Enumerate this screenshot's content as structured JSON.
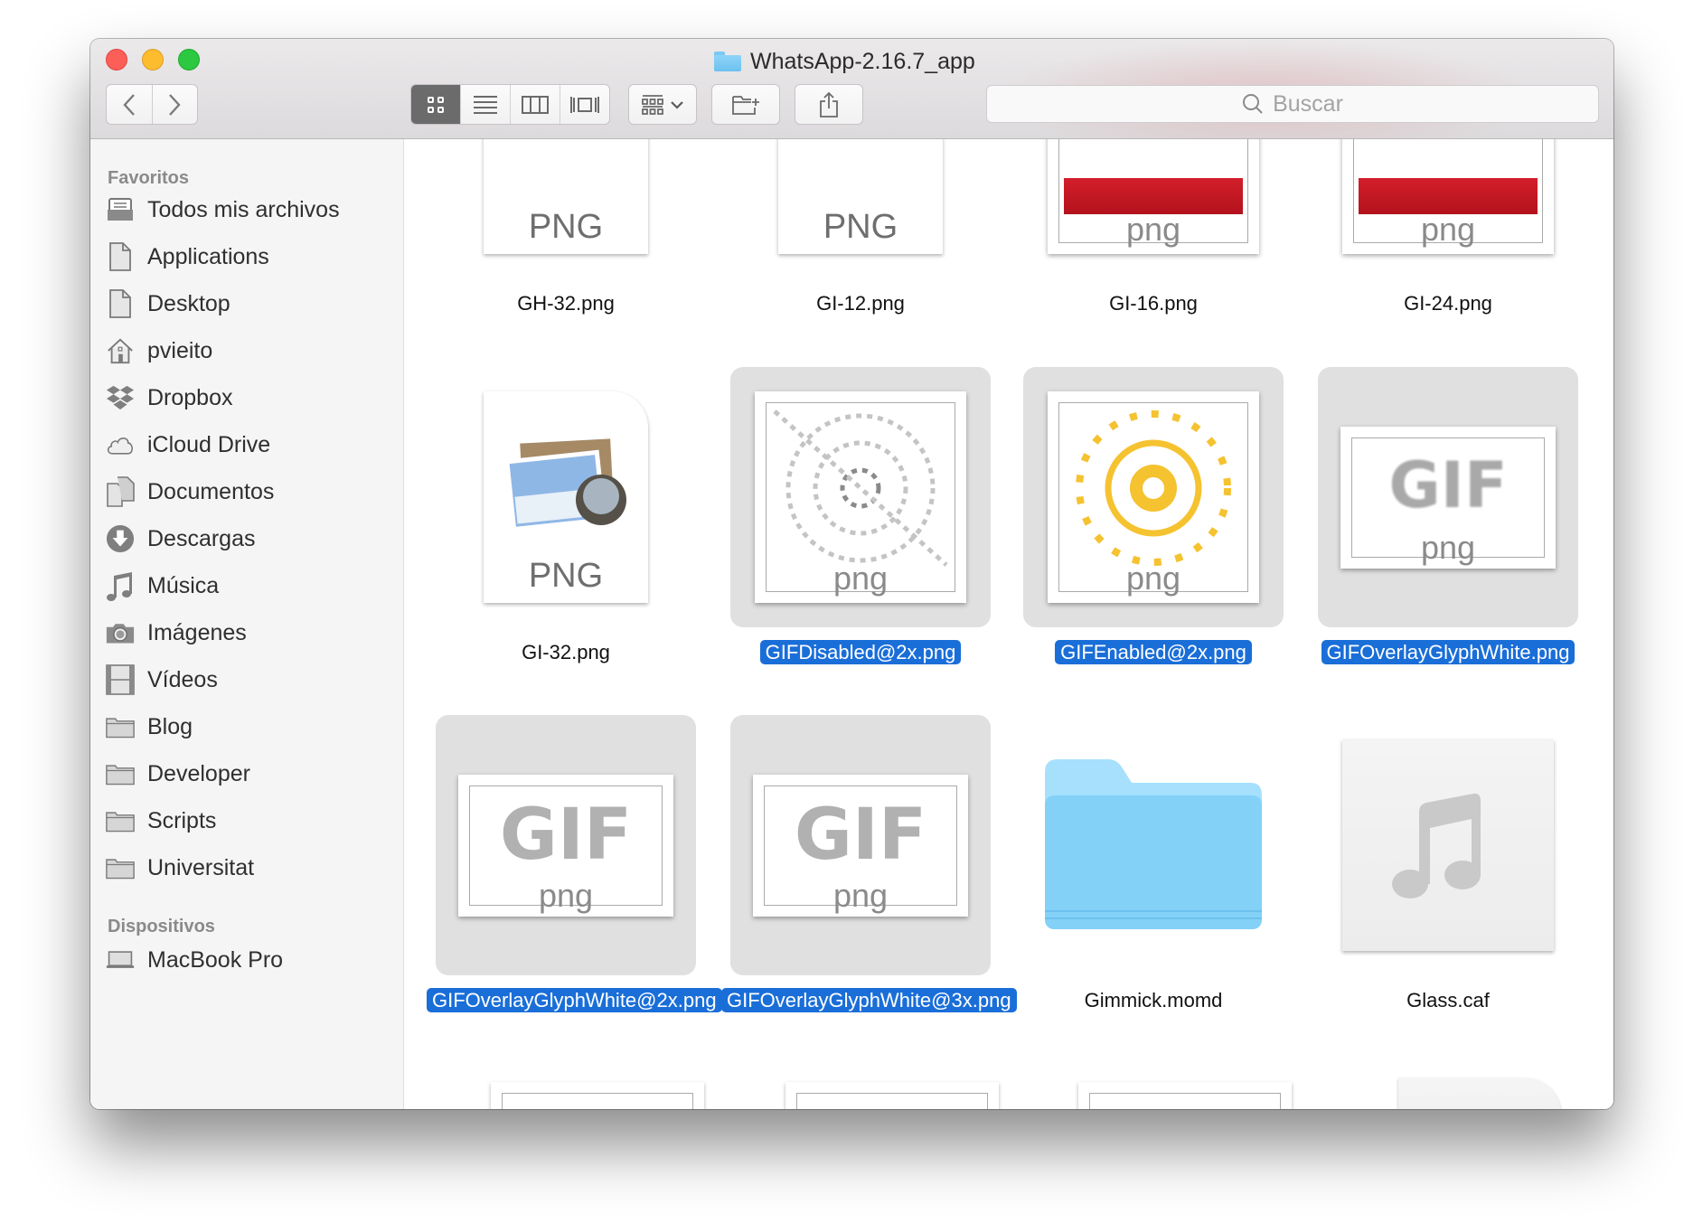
{
  "window": {
    "title": "WhatsApp-2.16.7_app",
    "title_icon": "folder-icon",
    "traffic_lights": [
      "close",
      "minimize",
      "zoom"
    ]
  },
  "toolbar": {
    "back_icon": "chevron-left-icon",
    "forward_icon": "chevron-right-icon",
    "view_modes": [
      {
        "name": "icon-view",
        "icon": "grid-icon",
        "active": true
      },
      {
        "name": "list-view",
        "icon": "list-icon",
        "active": false
      },
      {
        "name": "column-view",
        "icon": "columns-icon",
        "active": false
      },
      {
        "name": "cover-flow-view",
        "icon": "coverflow-icon",
        "active": false
      }
    ],
    "arrange_icon": "arrange-grid-icon",
    "new_folder_icon": "new-folder-icon",
    "share_icon": "share-icon",
    "search": {
      "placeholder": "Buscar",
      "value": ""
    }
  },
  "sidebar": {
    "sections": [
      {
        "heading": "Favoritos",
        "items": [
          {
            "label": "Todos mis archivos",
            "icon": "all-files-icon"
          },
          {
            "label": "Applications",
            "icon": "document-icon"
          },
          {
            "label": "Desktop",
            "icon": "document-icon"
          },
          {
            "label": "pvieito",
            "icon": "home-icon"
          },
          {
            "label": "Dropbox",
            "icon": "dropbox-icon"
          },
          {
            "label": "iCloud Drive",
            "icon": "cloud-icon"
          },
          {
            "label": "Documentos",
            "icon": "documents-icon"
          },
          {
            "label": "Descargas",
            "icon": "download-icon"
          },
          {
            "label": "Música",
            "icon": "music-note-icon"
          },
          {
            "label": "Imágenes",
            "icon": "camera-icon"
          },
          {
            "label": "Vídeos",
            "icon": "film-icon"
          },
          {
            "label": "Blog",
            "icon": "folder-icon"
          },
          {
            "label": "Developer",
            "icon": "folder-icon"
          },
          {
            "label": "Scripts",
            "icon": "folder-icon"
          },
          {
            "label": "Universitat",
            "icon": "folder-icon"
          }
        ]
      },
      {
        "heading": "Dispositivos",
        "items": [
          {
            "label": "MacBook Pro",
            "icon": "laptop-icon"
          }
        ]
      }
    ]
  },
  "files": [
    {
      "name": "GH-32.png",
      "kind": "png-doc",
      "ext_label": "PNG",
      "selected": false
    },
    {
      "name": "GI-12.png",
      "kind": "png-doc",
      "ext_label": "PNG",
      "selected": false
    },
    {
      "name": "GI-16.png",
      "kind": "ribbon-thumb",
      "ext_label": "png",
      "selected": false
    },
    {
      "name": "GI-24.png",
      "kind": "ribbon-thumb",
      "ext_label": "png",
      "selected": false
    },
    {
      "name": "GI-32.png",
      "kind": "png-doc",
      "ext_label": "PNG",
      "selected": false
    },
    {
      "name": "GIFDisabled@2x.png",
      "kind": "gif-disabled-thumb",
      "ext_label": "png",
      "selected": true
    },
    {
      "name": "GIFEnabled@2x.png",
      "kind": "gif-enabled-thumb",
      "ext_label": "png",
      "selected": true
    },
    {
      "name": "GIFOverlayGlyphWhite.png",
      "kind": "gif-overlay-thumb",
      "ext_label": "png",
      "thumb_text": "GIF",
      "selected": true
    },
    {
      "name": "GIFOverlayGlyphWhite@2x.png",
      "kind": "gif-overlay-thumb",
      "ext_label": "png",
      "thumb_text": "GIF",
      "selected": true
    },
    {
      "name": "GIFOverlayGlyphWhite@3x.png",
      "kind": "gif-overlay-thumb",
      "ext_label": "png",
      "thumb_text": "GIF",
      "selected": true
    },
    {
      "name": "Gimmick.momd",
      "kind": "folder",
      "selected": false
    },
    {
      "name": "Glass.caf",
      "kind": "audio-doc",
      "selected": false
    }
  ],
  "colors": {
    "selection": "#1a6ed8",
    "selection_bg": "#e0e0e0",
    "folder_blue": "#7fcdf5",
    "close": "#fc5f57",
    "minimize": "#fdbc2e",
    "zoom": "#2bc840"
  }
}
